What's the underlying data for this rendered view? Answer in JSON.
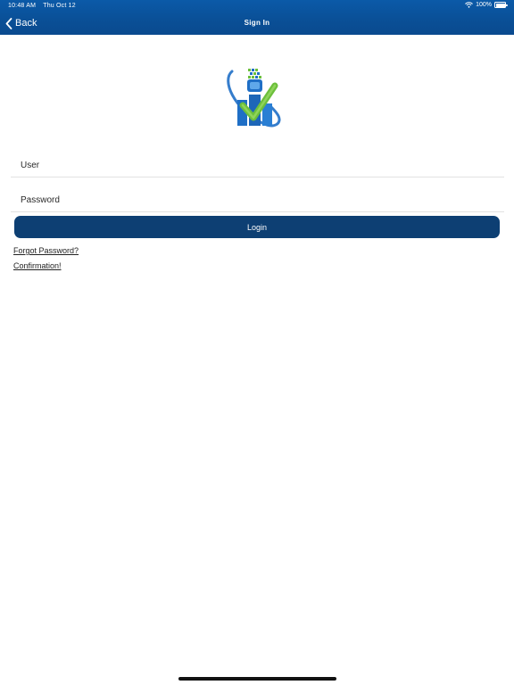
{
  "status_bar": {
    "time": "10:48 AM",
    "date": "Thu Oct 12",
    "battery": "100%",
    "icons": [
      "wifi-icon",
      "battery-icon"
    ]
  },
  "nav": {
    "back_label": "Back",
    "title": "Sign In",
    "back_icon": "chevron-left-icon"
  },
  "logo": {
    "name": "app-logo"
  },
  "form": {
    "user_placeholder": "User",
    "user_value": "",
    "password_placeholder": "Password",
    "password_value": "",
    "login_label": "Login"
  },
  "links": {
    "forgot": "Forgot Password?",
    "confirmation": "Confirmation!"
  },
  "colors": {
    "nav_bar": "#0a4f96",
    "primary_button": "#0d3f73",
    "logo_blue": "#1f6fc6",
    "logo_green": "#6cbf3c"
  }
}
